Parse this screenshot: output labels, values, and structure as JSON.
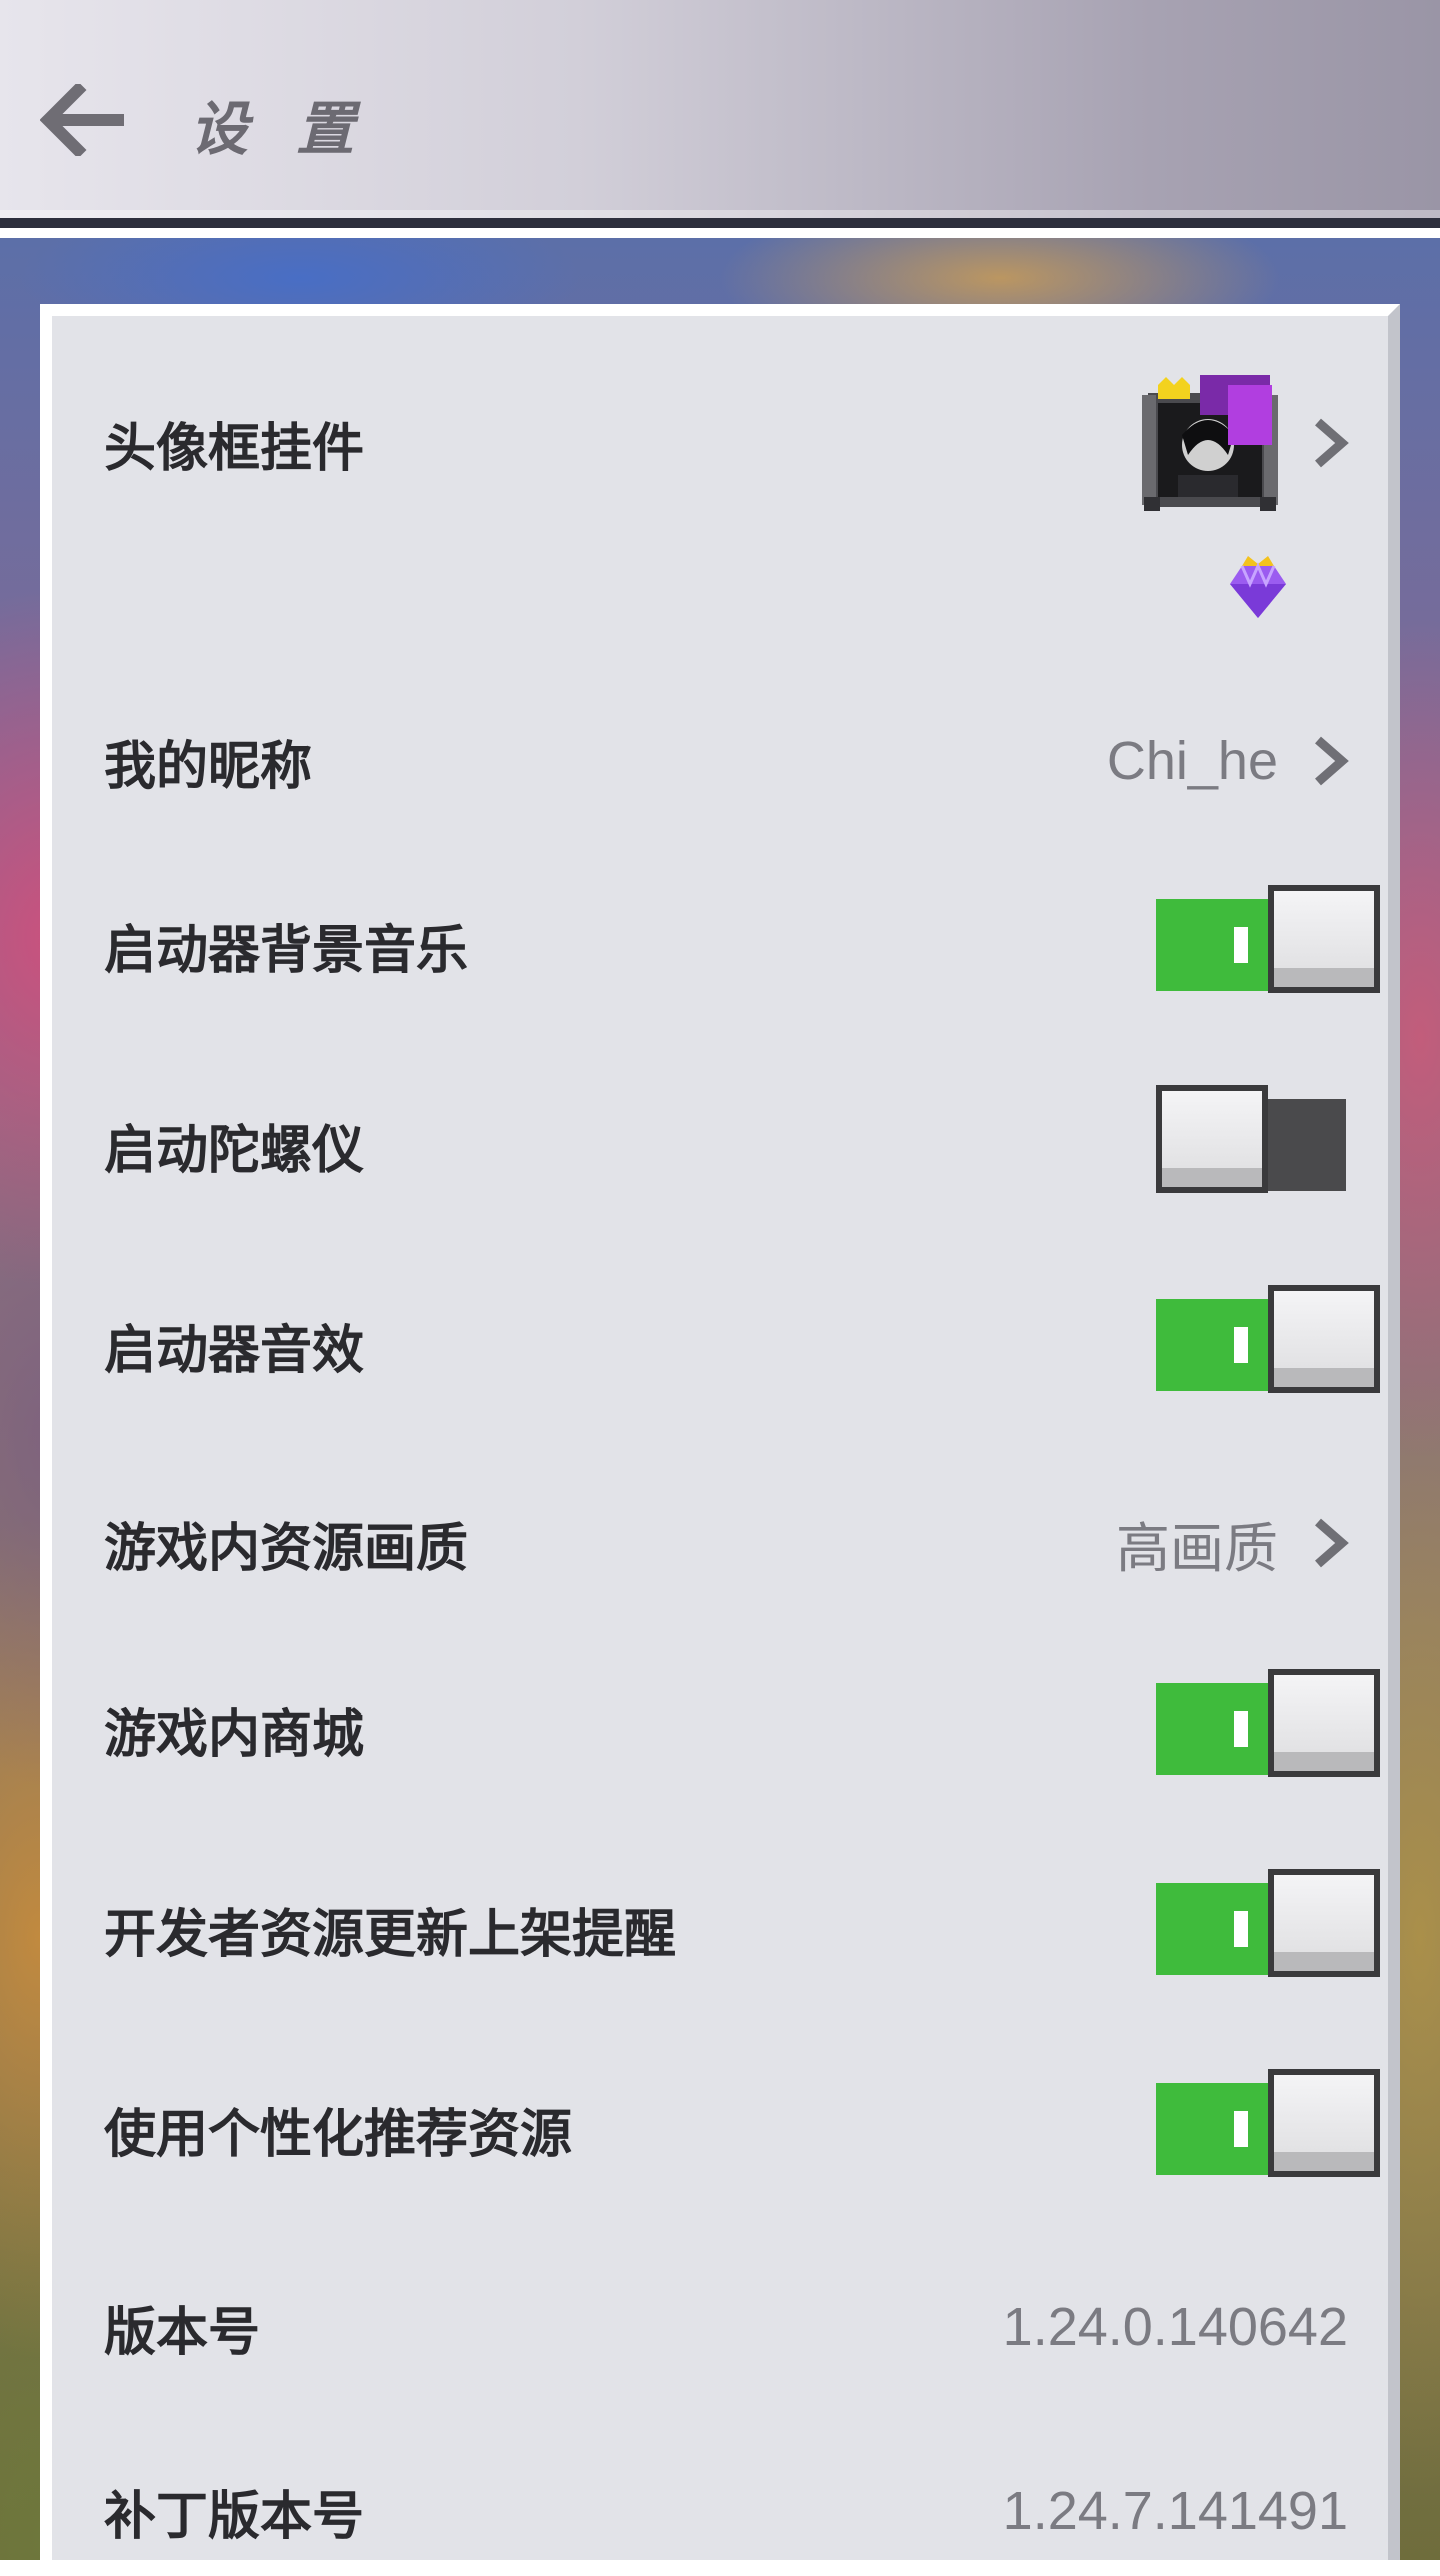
{
  "header": {
    "title": "设 置",
    "back_icon": "arrow-left-icon"
  },
  "settings": {
    "avatar_frame": {
      "label": "头像框挂件"
    },
    "nickname": {
      "label": "我的昵称",
      "value": "Chi_he"
    },
    "bg_music": {
      "label": "启动器背景音乐",
      "on": true
    },
    "gyroscope": {
      "label": "启动陀螺仪",
      "on": false
    },
    "sound_effects": {
      "label": "启动器音效",
      "on": true
    },
    "resource_quality": {
      "label": "游戏内资源画质",
      "value": "高画质"
    },
    "in_game_store": {
      "label": "游戏内商城",
      "on": true
    },
    "dev_update_reminder": {
      "label": "开发者资源更新上架提醒",
      "on": true
    },
    "personalized_recommend": {
      "label": "使用个性化推荐资源",
      "on": true
    },
    "version": {
      "label": "版本号",
      "value": "1.24.0.140642"
    },
    "patch_version": {
      "label": "补丁版本号",
      "value": "1.24.7.141491"
    }
  },
  "colors": {
    "toggle_on": "#3fbb3c",
    "toggle_off": "#4a4a4c",
    "panel": "#e2e3e8"
  }
}
